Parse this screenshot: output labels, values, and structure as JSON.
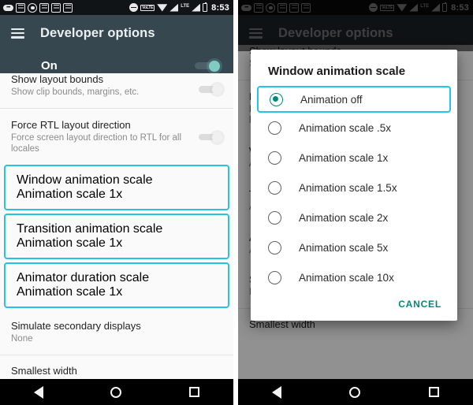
{
  "status_bar": {
    "time": "8:53",
    "volte_label": "VoLTE",
    "lte_label": "LTE",
    "icons": [
      "pill-dots-icon",
      "app-box-icon",
      "camera-icon",
      "app-box-icon",
      "app-box-icon",
      "app-box-icon",
      "do-not-disturb-icon",
      "volte-icon",
      "wifi-icon",
      "signal-icon",
      "lte-icon",
      "signal-icon",
      "battery-icon"
    ]
  },
  "toolbar": {
    "title": "Developer options",
    "menu_icon": "hamburger-icon"
  },
  "master_switch": {
    "label": "On",
    "state": "on"
  },
  "left_panel": {
    "items": [
      {
        "title": "Show layout bounds",
        "subtitle": "Show clip bounds, margins, etc.",
        "control": "switch-off",
        "highlighted": false,
        "clipped": true
      },
      {
        "title": "Force RTL layout direction",
        "subtitle": "Force screen layout direction to RTL for all locales",
        "control": "switch-off",
        "highlighted": false,
        "clipped": false
      },
      {
        "title": "Window animation scale",
        "subtitle": "Animation scale 1x",
        "control": "none",
        "highlighted": true,
        "clipped": false
      },
      {
        "title": "Transition animation scale",
        "subtitle": "Animation scale 1x",
        "control": "none",
        "highlighted": true,
        "clipped": false
      },
      {
        "title": "Animator duration scale",
        "subtitle": "Animation scale 1x",
        "control": "none",
        "highlighted": true,
        "clipped": false
      },
      {
        "title": "Simulate secondary displays",
        "subtitle": "None",
        "control": "none",
        "highlighted": false,
        "clipped": false
      },
      {
        "title": "Smallest width",
        "subtitle": "",
        "control": "none",
        "highlighted": false,
        "clipped": false
      }
    ]
  },
  "right_panel": {
    "background_items": [
      {
        "title": "Show layout bounds",
        "subtitle": "Show clip bounds, margins, etc."
      },
      {
        "title": "Force RTL layout direction",
        "subtitle": "Force screen layout direction to RTL for all locales"
      },
      {
        "title": "Window animation scale",
        "subtitle": "Animation scale 1x"
      },
      {
        "title": "Transition animation scale",
        "subtitle": "Animation scale 1x"
      },
      {
        "title": "Animator duration scale",
        "subtitle": "Animation scale 1x"
      },
      {
        "title": "Simulate secondary displays",
        "subtitle": "None"
      },
      {
        "title": "Smallest width",
        "subtitle": ""
      }
    ],
    "dialog": {
      "title": "Window animation scale",
      "options": [
        {
          "label": "Animation off",
          "selected": true
        },
        {
          "label": "Animation scale .5x",
          "selected": false
        },
        {
          "label": "Animation scale 1x",
          "selected": false
        },
        {
          "label": "Animation scale 1.5x",
          "selected": false
        },
        {
          "label": "Animation scale 2x",
          "selected": false
        },
        {
          "label": "Animation scale 5x",
          "selected": false
        },
        {
          "label": "Animation scale 10x",
          "selected": false
        }
      ],
      "cancel_label": "CANCEL"
    }
  },
  "nav_bar": {
    "back": "back-triangle-icon",
    "home": "home-circle-icon",
    "recents": "recents-square-icon"
  },
  "colors": {
    "toolbar": "#37474f",
    "accent_teal": "#00897b",
    "highlight_cyan": "#25c3e6",
    "switch_on": "#80cbc4"
  }
}
